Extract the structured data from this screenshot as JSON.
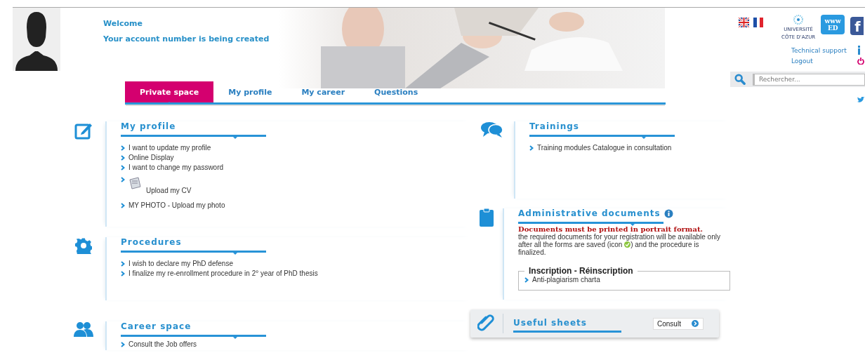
{
  "user": {
    "welcome": "Welcome",
    "account_status": "Your account number is being created"
  },
  "tabs": [
    {
      "label": "Private space",
      "selected": true
    },
    {
      "label": "My profile",
      "selected": false
    },
    {
      "label": "My career",
      "selected": false
    },
    {
      "label": "Questions",
      "selected": false
    }
  ],
  "logos": [
    {
      "kind": "university",
      "lines": [
        "UNIVERSITÉ",
        "CÔTE D'AZUR"
      ]
    },
    {
      "kind": "ed",
      "lines": [
        "www",
        "ED"
      ]
    },
    {
      "kind": "facebook",
      "lines": [
        "f"
      ]
    }
  ],
  "top_links": [
    {
      "label": "Technical support",
      "kind": "info"
    },
    {
      "label": "Logout",
      "kind": "logout"
    }
  ],
  "search": {
    "placeholder": "Rechercher..."
  },
  "left_sections": [
    {
      "title": "My profile",
      "items": [
        {
          "label": "I want to update my profile",
          "kind": "link"
        },
        {
          "label": "Online Display",
          "kind": "link"
        },
        {
          "label": "I want to change my password",
          "kind": "link"
        },
        {
          "label": "Upload my CV",
          "kind": "cv"
        },
        {
          "label": "MY PHOTO - Upload my photo",
          "kind": "link"
        }
      ]
    },
    {
      "title": "Procedures",
      "items": [
        {
          "label": "I wish to declare my PhD defense",
          "kind": "link"
        },
        {
          "label": "I finalize my re-enrollment procedure in 2° year of PhD thesis",
          "kind": "link"
        }
      ]
    },
    {
      "title": "Career space",
      "items": [
        {
          "label": "Consult the Job offers",
          "kind": "link"
        }
      ]
    }
  ],
  "right_sections": [
    {
      "title": "Trainings",
      "items": [
        {
          "label": "Training modules Catalogue in consultation",
          "kind": "link"
        }
      ]
    },
    {
      "title": "Administrative documents",
      "info": true,
      "notice": "Documents must be printed in portrait format.",
      "description": [
        "the required documents for your registration will be available only",
        "after all the forms are saved (icon",
        ") and the procedure is",
        "finalized."
      ],
      "group": {
        "title": "Inscription - Réinscription",
        "items": [
          {
            "label": "Anti-plagiarism charta",
            "kind": "link"
          }
        ]
      }
    }
  ],
  "useful_sheets": {
    "title": "Useful sheets",
    "button": "Consult"
  }
}
